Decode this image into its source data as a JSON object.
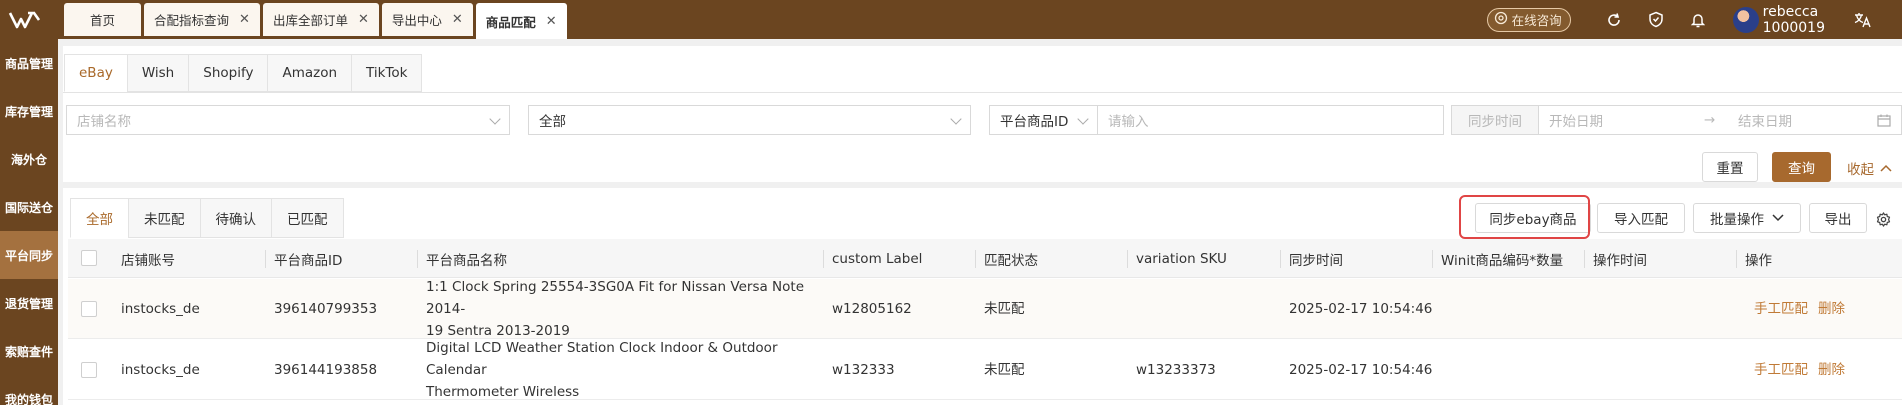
{
  "topbar": {
    "tabs": [
      {
        "label": "首页",
        "closable": false,
        "active": false
      },
      {
        "label": "合配指标查询",
        "closable": true,
        "active": false
      },
      {
        "label": "出库全部订单",
        "closable": true,
        "active": false
      },
      {
        "label": "导出中心",
        "closable": true,
        "active": false
      },
      {
        "label": "商品匹配",
        "closable": true,
        "active": true
      }
    ],
    "consult_label": "在线咨询",
    "user_name": "rebecca",
    "user_id": "1000019"
  },
  "sidebar": {
    "items": [
      {
        "label": "商品管理",
        "active": false
      },
      {
        "label": "库存管理",
        "active": false
      },
      {
        "label": "海外仓",
        "active": false
      },
      {
        "label": "国际送仓",
        "active": false
      },
      {
        "label": "平台同步",
        "active": true
      },
      {
        "label": "退货管理",
        "active": false
      },
      {
        "label": "索赔查件",
        "active": false
      },
      {
        "label": "我的钱包",
        "active": false
      }
    ]
  },
  "platform_tabs": [
    "eBay",
    "Wish",
    "Shopify",
    "Amazon",
    "TikTok"
  ],
  "filters": {
    "shop_placeholder": "店铺名称",
    "status_value": "全部",
    "id_type_value": "平台商品ID",
    "id_placeholder": "请输入",
    "sync_time_label": "同步时间",
    "start_placeholder": "开始日期",
    "arrow": "→",
    "end_placeholder": "结束日期",
    "reset_label": "重置",
    "query_label": "查询",
    "collapse_label": "收起"
  },
  "status_tabs": [
    "全部",
    "未匹配",
    "待确认",
    "已匹配"
  ],
  "actions": {
    "sync_label": "同步ebay商品",
    "import_label": "导入匹配",
    "batch_label": "批量操作",
    "export_label": "导出"
  },
  "table": {
    "columns": [
      "店铺账号",
      "平台商品ID",
      "平台商品名称",
      "custom Label",
      "匹配状态",
      "variation SKU",
      "同步时间",
      "Winit商品编码*数量",
      "操作时间",
      "操作"
    ],
    "rows": [
      {
        "shop": "instocks_de",
        "item_id": "396140799353",
        "name_line1": "1:1 Clock Spring 25554-3SG0A Fit for Nissan Versa Note 2014-",
        "name_line2": "19 Sentra 2013-2019",
        "custom_label": "w12805162",
        "status": "未匹配",
        "variation_sku": "",
        "sync_time": "2025-02-17 10:54:46",
        "winit_code": "",
        "op_time": "",
        "action_match": "手工匹配",
        "action_delete": "删除"
      },
      {
        "shop": "instocks_de",
        "item_id": "396144193858",
        "name_line1": "Digital LCD Weather Station Clock Indoor & Outdoor Calendar",
        "name_line2": "Thermometer Wireless",
        "custom_label": "w132333",
        "status": "未匹配",
        "variation_sku": "w13233373",
        "sync_time": "2025-02-17 10:54:46",
        "winit_code": "",
        "op_time": "",
        "action_match": "手工匹配",
        "action_delete": "删除"
      }
    ]
  },
  "colors": {
    "brand_brown": "#6b4520",
    "accent": "#a7692e",
    "highlight": "#e04545"
  }
}
